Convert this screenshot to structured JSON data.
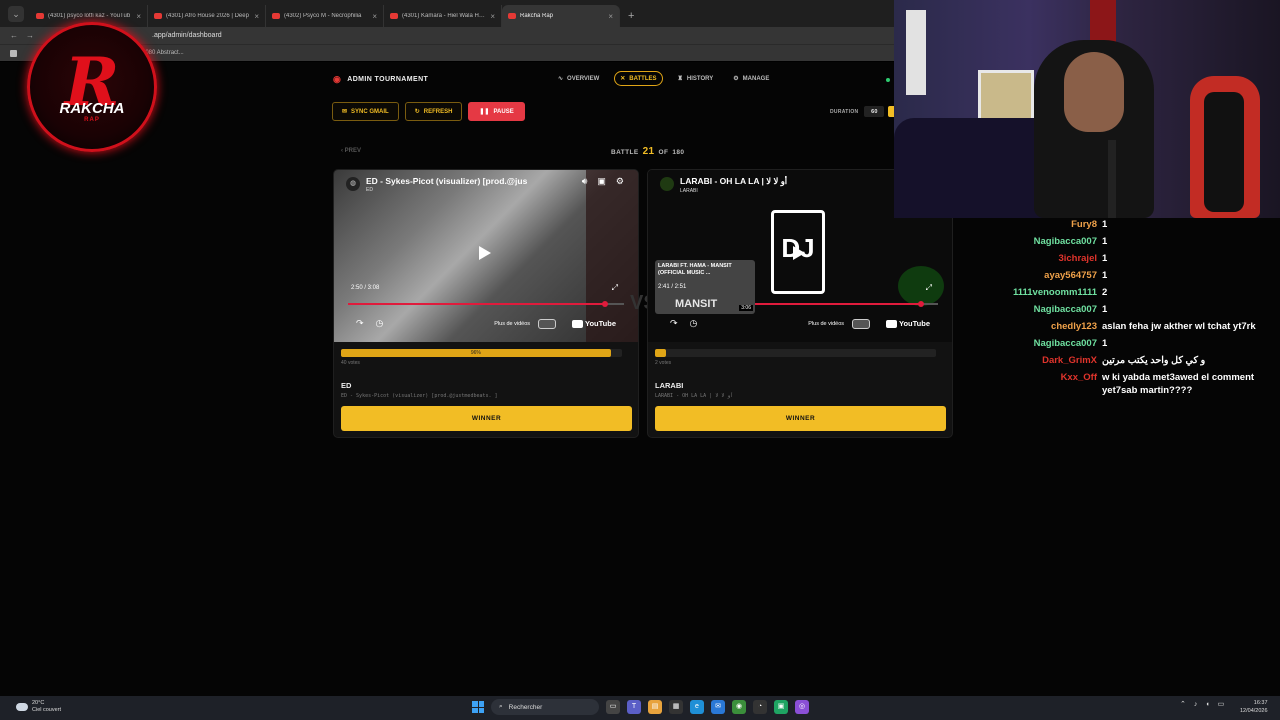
{
  "browser": {
    "tabs": [
      {
        "label": "(4301) psyco lotfi kaz - YouTub",
        "active": false
      },
      {
        "label": "(4301) Afro House 2026 | Deep",
        "active": false
      },
      {
        "label": "(4302) Psyco M - Necrophilia",
        "active": false
      },
      {
        "label": "(4301) Kamara - Hiel Wala Hrae",
        "active": false
      },
      {
        "label": "Rakcha Rap",
        "active": true
      }
    ],
    "url": ".app/admin/dashboard",
    "bookmark": "x1080 Abstract..."
  },
  "header": {
    "brand": "ADMIN TOURNAMENT",
    "nav": [
      {
        "label": "OVERVIEW",
        "icon": "activity-icon",
        "active": false
      },
      {
        "label": "BATTLES",
        "icon": "swords-icon",
        "active": true
      },
      {
        "label": "HISTORY",
        "icon": "trophy-icon",
        "active": false
      },
      {
        "label": "MANAGE",
        "icon": "gear-icon",
        "active": false
      }
    ]
  },
  "actions": {
    "sync": "SYNC GMAIL",
    "refresh": "REFRESH",
    "pause": "PAUSE",
    "duration_label": "DURATION",
    "duration_value": "60"
  },
  "battle": {
    "prev": "‹ PREV",
    "label": "BATTLE",
    "current": "21",
    "of": "OF",
    "total": "180",
    "vs": "VS"
  },
  "contenders": [
    {
      "video_title": "ED - Sykes-Picot (visualizer) [prod.@jus",
      "channel": "ED",
      "time": "2:50 / 3:08",
      "progress": 0.93,
      "more_videos": "Plus de vidéos",
      "youtube": "YouTube",
      "vote_pct": 96,
      "vote_pct_label": "96%",
      "votes": "40 votes",
      "name": "ED",
      "subtitle": "ED - Sykes-Picot (visualizer) [prod.@justmedbeats. ]",
      "winner": "WINNER"
    },
    {
      "video_title": "LARABI - OH LA LA | أو لا لا",
      "channel": "LARABI",
      "time": "2:41 / 2:51",
      "progress": 0.94,
      "more_videos": "Plus de vidéos",
      "youtube": "YouTube",
      "vote_pct": 4,
      "votes": "2 votes",
      "name": "LARABI",
      "subtitle": "LARABI - OH LA LA | أو لا لا",
      "winner": "WINNER",
      "rec_title": "LARABI FT. HAMA - MANSIT (OFFICIAL MUSIC ...",
      "rec_duration": "3:06",
      "rec_mark": "MANSIT"
    }
  ],
  "logo": {
    "letter": "R",
    "wordmark": "RAKCHA",
    "sub": "RAP"
  },
  "chat": [
    {
      "user": "Fury8",
      "text": "1",
      "color": "#f0a24a"
    },
    {
      "user": "Nagibacca007",
      "text": "1",
      "color": "#6fe0a0"
    },
    {
      "user": "3ichrajel",
      "text": "1",
      "color": "#e0342c"
    },
    {
      "user": "ayay564757",
      "text": "1",
      "color": "#f0a24a"
    },
    {
      "user": "1111venoomm1111",
      "text": "2",
      "color": "#6fe0a0"
    },
    {
      "user": "Nagibacca007",
      "text": "1",
      "color": "#6fe0a0"
    },
    {
      "user": "chedly123",
      "text": "aslan feha jw akther wl tchat yt7rk",
      "color": "#f0a24a"
    },
    {
      "user": "Nagibacca007",
      "text": "1",
      "color": "#6fe0a0"
    },
    {
      "user": "Dark_GrimX",
      "text": "و كي كل واحد يكتب مرتين",
      "color": "#e0342c"
    },
    {
      "user": "Kxx_Off",
      "text": "w ki yabda met3awed el comment yet7sab martin????",
      "color": "#e0342c"
    }
  ],
  "taskbar": {
    "temp": "20°C",
    "weather": "Ciel couvert",
    "search": "Rechercher",
    "time": "16:37",
    "date": "12/04/2026"
  }
}
